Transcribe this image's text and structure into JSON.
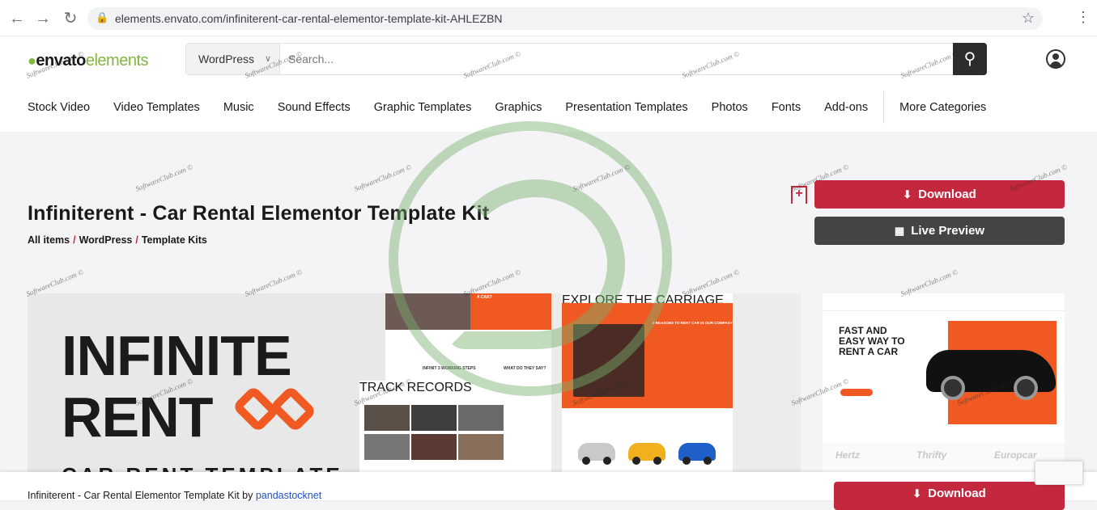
{
  "browser": {
    "url": "elements.envato.com/infiniterent-car-rental-elementor-template-kit-AHLEZBN",
    "back_icon": "←",
    "forward_icon": "→",
    "reload_icon": "↻",
    "lock_icon": "🔒",
    "star_icon": "☆",
    "menu_icon": "⋮"
  },
  "header": {
    "logo_part1": "envato",
    "logo_part2": "elements",
    "search_category": "WordPress",
    "search_placeholder": "Search...",
    "search_icon": "⚲",
    "categories": [
      "Stock Video",
      "Video Templates",
      "Music",
      "Sound Effects",
      "Graphic Templates",
      "Graphics",
      "Presentation Templates",
      "Photos",
      "Fonts",
      "Add-ons",
      "More Categories"
    ]
  },
  "item": {
    "title": "Infiniterent - Car Rental Elementor Template Kit",
    "breadcrumb": [
      "All items",
      "WordPress",
      "Template Kits"
    ],
    "download_label": "Download",
    "live_preview_label": "Live Preview",
    "favorite_icon": "+"
  },
  "preview": {
    "big_word_1": "INFINITE",
    "big_word_2": "RENT",
    "sub_word": "CAR RENT TEMPLATE",
    "label_track": "TRACK RECORDS",
    "label_steps": "INFINIT 3 WORKING STEPS",
    "label_what": "WHAT DO THEY SAY?",
    "label_reasons": "5 REASONS TO RENT CAR IN OUR COMPANY",
    "label_explore": "EXPLORE THE CARRIAGE",
    "label_car": "A CAR?"
  },
  "thumbnail": {
    "headline_1": "FAST AND",
    "headline_2": "EASY WAY TO",
    "headline_3": "RENT A CAR",
    "brands": [
      "Hertz",
      "Thrifty",
      "Europcar"
    ]
  },
  "bottom_bar": {
    "title": "Infiniterent - Car Rental Elementor Template Kit by",
    "author": "pandastocknet",
    "download_label": "Download"
  },
  "watermark": {
    "text": "SoftwareClub.com ©"
  },
  "colors": {
    "accent": "#c4283f",
    "dark_button": "#444444",
    "brand_green": "#82b541",
    "template_orange": "#f05a22"
  }
}
